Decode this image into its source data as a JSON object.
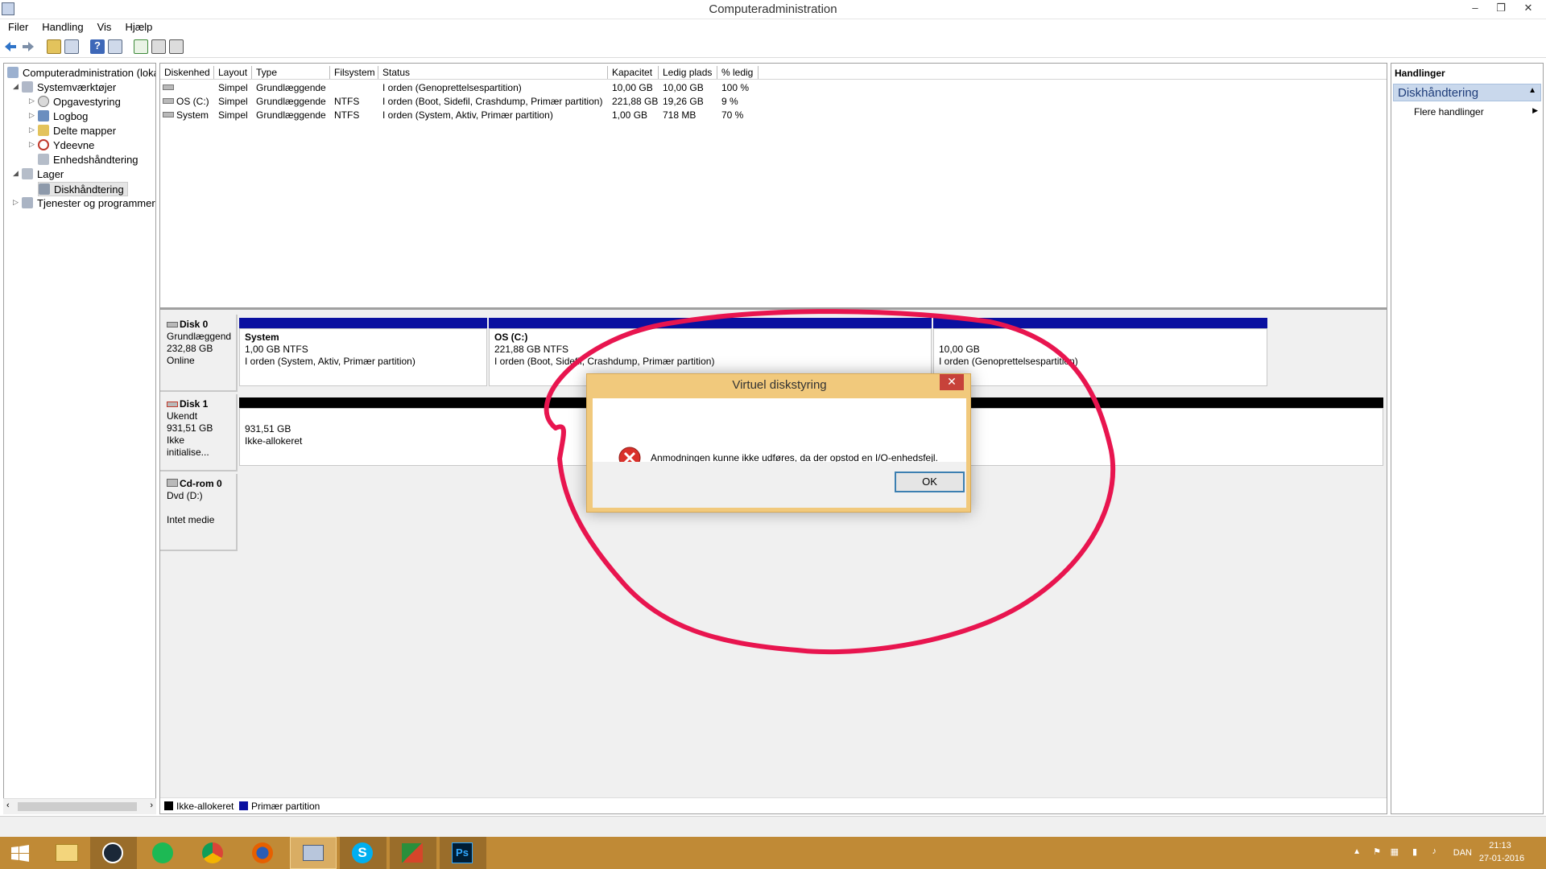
{
  "window": {
    "title": "Computeradministration",
    "min": "–",
    "restore": "❐",
    "close": "✕"
  },
  "menu": [
    "Filer",
    "Handling",
    "Vis",
    "Hjælp"
  ],
  "tree": {
    "root": "Computeradministration (lokal",
    "system_tools": "Systemværktøjer",
    "task_scheduler": "Opgavestyring",
    "event_viewer": "Logbog",
    "shared_folders": "Delte mapper",
    "performance": "Ydeevne",
    "device_manager": "Enhedshåndtering",
    "storage": "Lager",
    "disk_management": "Diskhåndtering",
    "services": "Tjenester og programmer"
  },
  "volumes": {
    "columns": [
      "Diskenhed",
      "Layout",
      "Type",
      "Filsystem",
      "Status",
      "Kapacitet",
      "Ledig plads",
      "% ledig"
    ],
    "rows": [
      [
        "",
        "Simpel",
        "Grundlæggende",
        "",
        "I orden (Genoprettelsespartition)",
        "10,00 GB",
        "10,00 GB",
        "100 %"
      ],
      [
        "OS (C:)",
        "Simpel",
        "Grundlæggende",
        "NTFS",
        "I orden (Boot, Sidefil, Crashdump, Primær partition)",
        "221,88 GB",
        "19,26 GB",
        "9 %"
      ],
      [
        "System",
        "Simpel",
        "Grundlæggende",
        "NTFS",
        "I orden (System, Aktiv, Primær partition)",
        "1,00 GB",
        "718 MB",
        "70 %"
      ]
    ]
  },
  "disks": {
    "disk0": {
      "name": "Disk 0",
      "type": "Grundlæggend",
      "size": "232,88 GB",
      "state": "Online"
    },
    "disk1": {
      "name": "Disk 1",
      "type": "Ukendt",
      "size": "931,51 GB",
      "state": "Ikke initialise..."
    },
    "cdrom": {
      "name": "Cd-rom 0",
      "type": "Dvd (D:)",
      "state": "Intet medie"
    }
  },
  "partitions": {
    "system": {
      "name": "System",
      "size": "1,00 GB NTFS",
      "status": "I orden (System, Aktiv, Primær partition)"
    },
    "os": {
      "name": "OS  (C:)",
      "size": "221,88 GB NTFS",
      "status": "I orden (Boot, Sidefil, Crashdump, Primær partition)"
    },
    "recovery": {
      "size": "10,00 GB",
      "status": "I orden (Genoprettelsespartition)"
    },
    "unalloc": {
      "size": "931,51 GB",
      "status": "Ikke-allokeret"
    }
  },
  "legend": {
    "unallocated": "Ikke-allokeret",
    "primary": "Primær partition"
  },
  "actions": {
    "header": "Handlinger",
    "section": "Diskhåndtering",
    "more": "Flere handlinger"
  },
  "dialog": {
    "title": "Virtuel diskstyring",
    "message": "Anmodningen kunne ikke udføres, da der opstod en I/O-enhedsfejl.",
    "ok": "OK"
  },
  "taskbar": {
    "lang": "DAN",
    "time": "21:13",
    "date": "27-01-2016"
  },
  "colors": {
    "primary": "#0a10a0",
    "unallocated": "#000000",
    "taskbar": "#c08a36",
    "annotation": "#e8154f"
  }
}
